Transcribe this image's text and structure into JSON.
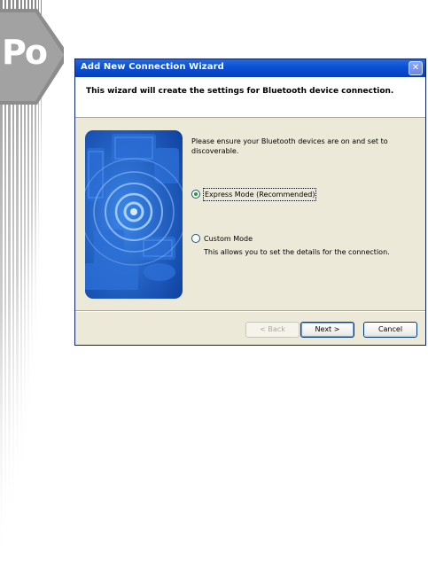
{
  "decoration": {
    "logo_text": "Po"
  },
  "dialog": {
    "title": "Add New Connection Wizard",
    "close_glyph": "✕",
    "header_text": "This wizard will create the settings for Bluetooth device connection.",
    "instruction": "Please ensure your Bluetooth devices are on and set to discoverable.",
    "options": [
      {
        "label": "Express Mode (Recommended)",
        "selected": true
      },
      {
        "label": "Custom Mode",
        "selected": false
      }
    ],
    "custom_description": "This allows you to set the details for the connection.",
    "buttons": {
      "back": "< Back",
      "next": "Next >",
      "cancel": "Cancel"
    }
  },
  "colors": {
    "titlebar": "#0b52d6",
    "dialog_bg": "#ece9d8",
    "illustration_blue": "#1559c2"
  },
  "icons": [
    "close-icon",
    "bluetooth-wizard-illustration"
  ]
}
